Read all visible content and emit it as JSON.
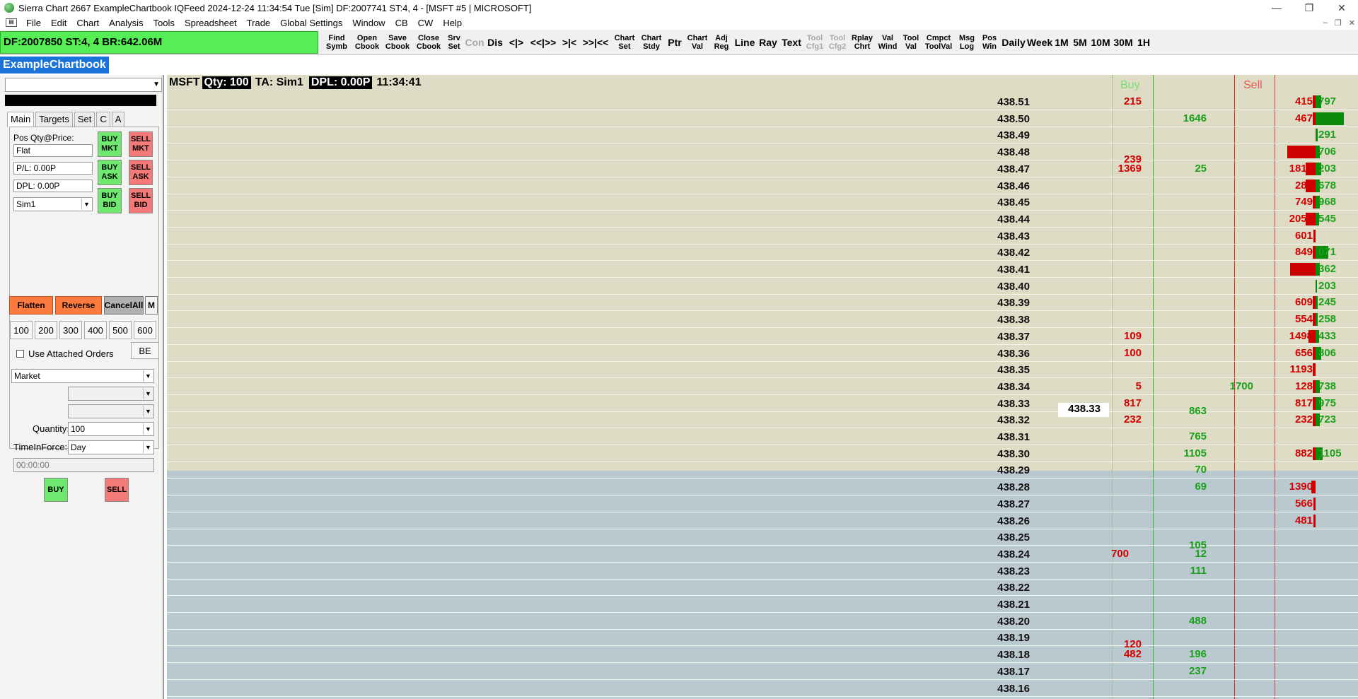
{
  "window": {
    "title": "Sierra Chart 2667 ExampleChartbook IQFeed 2024-12-24  11:34:54 Tue [Sim] DF:2007741  ST:4, 4 - [MSFT #5 | MICROSOFT]",
    "min": "—",
    "max": "❐",
    "close": "✕"
  },
  "menu": [
    "File",
    "Edit",
    "Chart",
    "Analysis",
    "Tools",
    "Spreadsheet",
    "Trade",
    "Global Settings",
    "Window",
    "CB",
    "CW",
    "Help"
  ],
  "toolbar": {
    "status": "DF:2007850  ST:4, 4  BR:642.06M",
    "buttons": [
      {
        "label": "Find\nSymb"
      },
      {
        "label": "Open\nCbook"
      },
      {
        "label": "Save\nCbook"
      },
      {
        "label": "Close\nCbook"
      },
      {
        "label": "Srv\nSet"
      },
      {
        "label": "Con",
        "disabled": true
      },
      {
        "label": "Dis"
      },
      {
        "label": "<|>"
      },
      {
        "label": "<<|>>"
      },
      {
        "label": ">|<"
      },
      {
        "label": ">>|<<"
      },
      {
        "label": "Chart\nSet"
      },
      {
        "label": "Chart\nStdy"
      },
      {
        "label": "Ptr"
      },
      {
        "label": "Chart\nVal"
      },
      {
        "label": "Adj\nReg"
      },
      {
        "label": "Line"
      },
      {
        "label": "Ray"
      },
      {
        "label": "Text"
      },
      {
        "label": "Tool\nCfg1",
        "disabled": true
      },
      {
        "label": "Tool\nCfg2",
        "disabled": true
      },
      {
        "label": "Rplay\nChrt"
      },
      {
        "label": "Val\nWind"
      },
      {
        "label": "Tool\nVal"
      },
      {
        "label": "Cmpct\nToolVal"
      },
      {
        "label": "Msg\nLog"
      },
      {
        "label": "Pos\nWin"
      },
      {
        "label": "Daily"
      },
      {
        "label": "Week"
      },
      {
        "label": "1M"
      },
      {
        "label": "5M"
      },
      {
        "label": "10M"
      },
      {
        "label": "30M"
      },
      {
        "label": "1H"
      }
    ]
  },
  "chartbook_tab": "ExampleChartbook",
  "trade_panel": {
    "tabs": [
      "Main",
      "Targets",
      "Set",
      "C",
      "A"
    ],
    "pos_label": "Pos Qty@Price:",
    "pos_value": "Flat",
    "pl_value": "P/L: 0.00P",
    "dpl_value": "DPL: 0.00P",
    "account": "Sim1",
    "buy_mkt": "BUY\nMKT",
    "sell_mkt": "SELL\nMKT",
    "buy_ask": "BUY\nASK",
    "sell_ask": "SELL\nASK",
    "buy_bid": "BUY\nBID",
    "sell_bid": "SELL\nBID",
    "flatten": "Flatten",
    "reverse": "Reverse",
    "cancel_all": "CancelAll",
    "m": "M",
    "qty_buttons": [
      "100",
      "200",
      "300",
      "400",
      "500",
      "600"
    ],
    "use_attached": "Use Attached Orders",
    "be": "BE",
    "order_type": "Market",
    "quantity_label": "Quantity:",
    "quantity": "100",
    "tif_label": "TimeInForce:",
    "tif": "Day",
    "time": "00:00:00",
    "buy": "BUY",
    "sell": "SELL"
  },
  "chart": {
    "symbol": "MSFT",
    "qty": "Qty: 100",
    "ta": "TA: Sim1",
    "dpl": "DPL: 0.00P",
    "time": "11:34:41",
    "buy_header": "Buy",
    "sell_header": "Sell",
    "last_price": "438.33",
    "prices": [
      "438.51",
      "438.50",
      "438.49",
      "438.48",
      "438.47",
      "438.46",
      "438.45",
      "438.44",
      "438.43",
      "438.42",
      "438.41",
      "438.40",
      "438.39",
      "438.38",
      "438.37",
      "438.36",
      "438.35",
      "438.34",
      "438.33",
      "438.32",
      "438.31",
      "438.30",
      "438.29",
      "438.28",
      "438.27",
      "438.26",
      "438.25",
      "438.24",
      "438.23",
      "438.22",
      "438.21",
      "438.20",
      "438.19",
      "438.18",
      "438.17",
      "438.16"
    ],
    "cells": [
      {
        "row": 0,
        "col": "red",
        "text": "215"
      },
      {
        "row": 1,
        "col": "green",
        "text": "1646"
      },
      {
        "row": 3.45,
        "col": "red",
        "text": "239"
      },
      {
        "row": 4,
        "col": "red",
        "text": "1369"
      },
      {
        "row": 4,
        "col": "green",
        "text": "25"
      },
      {
        "row": 14,
        "col": "red",
        "text": "109"
      },
      {
        "row": 15,
        "col": "red",
        "text": "100"
      },
      {
        "row": 17,
        "col": "red",
        "text": "5"
      },
      {
        "row": 17,
        "col": "sellask",
        "text": "1700"
      },
      {
        "row": 18,
        "col": "red",
        "text": "817"
      },
      {
        "row": 18.5,
        "col": "green",
        "text": "863"
      },
      {
        "row": 19,
        "col": "red",
        "text": "232"
      },
      {
        "row": 20,
        "col": "green",
        "text": "765"
      },
      {
        "row": 21,
        "col": "green",
        "text": "1105"
      },
      {
        "row": 22,
        "col": "green",
        "text": "70"
      },
      {
        "row": 23,
        "col": "green",
        "text": "69"
      },
      {
        "row": 26.5,
        "col": "green",
        "text": "105"
      },
      {
        "row": 27,
        "col": "buybid",
        "text": "700"
      },
      {
        "row": 27,
        "col": "green",
        "text": "12"
      },
      {
        "row": 28,
        "col": "green",
        "text": "111"
      },
      {
        "row": 31,
        "col": "green",
        "text": "488"
      },
      {
        "row": 32.4,
        "col": "red",
        "text": "120"
      },
      {
        "row": 33,
        "col": "red",
        "text": "482"
      },
      {
        "row": 33,
        "col": "green",
        "text": "196"
      },
      {
        "row": 34,
        "col": "green",
        "text": "237"
      }
    ],
    "profile": [
      {
        "row": 0,
        "red": "415",
        "green": "797",
        "rbar": 4,
        "gbar": 8
      },
      {
        "row": 1,
        "red": "467",
        "green": "",
        "rbar": 4,
        "gbar": 40
      },
      {
        "row": 2,
        "red": "",
        "green": "291",
        "rbar": 0,
        "gbar": 3
      },
      {
        "row": 3,
        "red": "",
        "green": "706",
        "rbar": 40,
        "gbar": 6
      },
      {
        "row": 4,
        "red": "1810",
        "green": "203",
        "rbar": 14,
        "gbar": 8
      },
      {
        "row": 5,
        "red": "285",
        "green": "678",
        "rbar": 14,
        "gbar": 6
      },
      {
        "row": 6,
        "red": "749",
        "green": "968",
        "rbar": 4,
        "gbar": 6
      },
      {
        "row": 7,
        "red": "2050",
        "green": "545",
        "rbar": 14,
        "gbar": 5
      },
      {
        "row": 8,
        "red": "601",
        "green": "",
        "rbar": 3,
        "gbar": 0
      },
      {
        "row": 9,
        "red": "849",
        "green": "071",
        "rbar": 4,
        "gbar": 18
      },
      {
        "row": 10,
        "red": "5",
        "green": "362",
        "rbar": 36,
        "gbar": 6
      },
      {
        "row": 11,
        "red": "",
        "green": "203",
        "rbar": 0,
        "gbar": 2
      },
      {
        "row": 12,
        "red": "609",
        "green": "245",
        "rbar": 4,
        "gbar": 3
      },
      {
        "row": 13,
        "red": "554",
        "green": "258",
        "rbar": 4,
        "gbar": 3
      },
      {
        "row": 14,
        "red": "1498",
        "green": "433",
        "rbar": 10,
        "gbar": 5
      },
      {
        "row": 15,
        "red": "656",
        "green": "806",
        "rbar": 4,
        "gbar": 8
      },
      {
        "row": 16,
        "red": "1193",
        "green": "",
        "rbar": 4,
        "gbar": 0
      },
      {
        "row": 17,
        "red": "128",
        "green": "738",
        "rbar": 4,
        "gbar": 6
      },
      {
        "row": 18,
        "red": "817",
        "green": "975",
        "rbar": 4,
        "gbar": 8
      },
      {
        "row": 19,
        "red": "232",
        "green": "723",
        "rbar": 4,
        "gbar": 6
      },
      {
        "row": 21,
        "red": "882",
        "green": "1105",
        "rbar": 4,
        "gbar": 10
      },
      {
        "row": 23,
        "red": "1390",
        "green": "",
        "rbar": 6,
        "gbar": 0
      },
      {
        "row": 24,
        "red": "566",
        "green": "",
        "rbar": 3,
        "gbar": 0
      },
      {
        "row": 25,
        "red": "481",
        "green": "",
        "rbar": 3,
        "gbar": 0
      }
    ],
    "colors": {
      "upper": "#dedcc4",
      "lower": "#b9c9cf",
      "buy": "#1aa01a",
      "sell": "#d40000"
    }
  }
}
